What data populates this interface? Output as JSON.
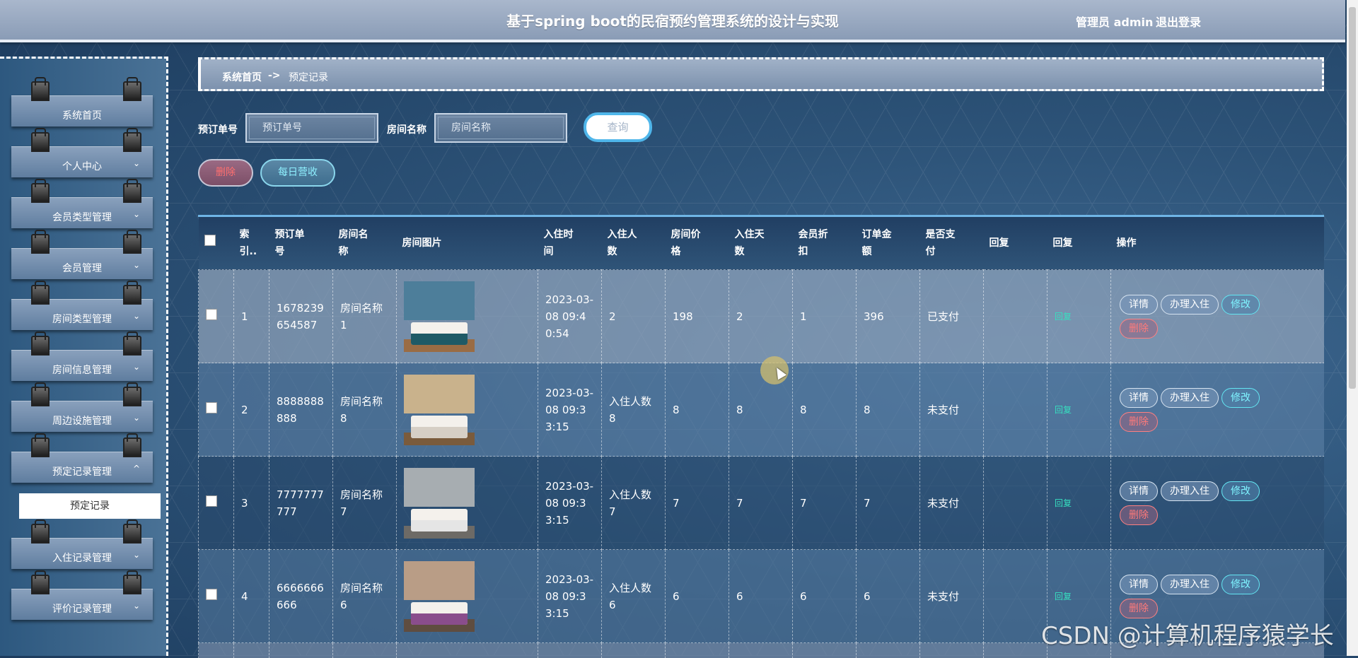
{
  "header": {
    "title": "基于spring boot的民宿预约管理系统的设计与实现",
    "user": "管理员 admin",
    "logout": "退出登录"
  },
  "sidebar": {
    "items": [
      {
        "label": "系统首页",
        "chevron": ""
      },
      {
        "label": "个人中心",
        "chevron": "⌄"
      },
      {
        "label": "会员类型管理",
        "chevron": "⌄"
      },
      {
        "label": "会员管理",
        "chevron": "⌄"
      },
      {
        "label": "房间类型管理",
        "chevron": "⌄"
      },
      {
        "label": "房间信息管理",
        "chevron": "⌄"
      },
      {
        "label": "周边设施管理",
        "chevron": "⌄"
      },
      {
        "label": "预定记录管理",
        "chevron": "^"
      },
      {
        "label": "入住记录管理",
        "chevron": "⌄"
      },
      {
        "label": "评价记录管理",
        "chevron": "⌄"
      }
    ],
    "submenu_active": "预定记录"
  },
  "breadcrumb": {
    "home": "系统首页",
    "sep": "->",
    "current": "预定记录"
  },
  "search": {
    "order_label": "预订单号",
    "order_placeholder": "预订单号",
    "room_label": "房间名称",
    "room_placeholder": "房间名称",
    "query": "查询"
  },
  "actions": {
    "delete": "删除",
    "daily_revenue": "每日营收"
  },
  "table": {
    "headers": [
      "",
      "索引",
      "预订单号",
      "房间名称",
      "房间图片",
      "入住时间",
      "入住人数",
      "房间价格",
      "入住天数",
      "会员折扣",
      "订单金额",
      "是否支付",
      "回复",
      "回复",
      "操作"
    ],
    "header_display": {
      "index": "索\n引..",
      "order_no": "预订单\n号",
      "room_name": "房间名\n称",
      "room_img": "房间图片",
      "checkin_time": "入住时\n间",
      "people": "入住人\n数",
      "price": "房间价\n格",
      "days": "入住天\n数",
      "discount": "会员折\n扣",
      "amount": "订单金\n额",
      "paid": "是否支\n付",
      "reply1": "回复",
      "reply2": "回复",
      "ops": "操作"
    },
    "rows": [
      {
        "index": "1",
        "order_no": "1678239654587",
        "room_name": "房间名称1",
        "time": "2023-03-08 09:40:54",
        "people": "2",
        "price": "198",
        "days": "2",
        "discount": "1",
        "amount": "396",
        "paid": "已支付",
        "reply": "回复",
        "img": {
          "wall": "#4d7e9a",
          "blanket": "#1f5a66",
          "floor": "#9a6c44"
        }
      },
      {
        "index": "2",
        "order_no": "8888888888",
        "room_name": "房间名称8",
        "time": "2023-03-08 09:33:15",
        "people": "入住人数8",
        "price": "8",
        "days": "8",
        "discount": "8",
        "amount": "8",
        "paid": "未支付",
        "reply": "回复",
        "img": {
          "wall": "#c9b28c",
          "blanket": "#d6cfc5",
          "floor": "#7a5b3c"
        }
      },
      {
        "index": "3",
        "order_no": "7777777777",
        "room_name": "房间名称7",
        "time": "2023-03-08 09:33:15",
        "people": "入住人数7",
        "price": "7",
        "days": "7",
        "discount": "7",
        "amount": "7",
        "paid": "未支付",
        "reply": "回复",
        "img": {
          "wall": "#a7adb1",
          "blanket": "#e5e5e5",
          "floor": "#6d6a66"
        }
      },
      {
        "index": "4",
        "order_no": "6666666666",
        "room_name": "房间名称6",
        "time": "2023-03-08 09:33:15",
        "people": "入住人数6",
        "price": "6",
        "days": "6",
        "discount": "6",
        "amount": "6",
        "paid": "未支付",
        "reply": "回复",
        "img": {
          "wall": "#b99d86",
          "blanket": "#8a4d8c",
          "floor": "#5f4d40"
        }
      }
    ],
    "row_buttons": {
      "detail": "详情",
      "checkin": "办理入住",
      "edit": "修改",
      "delete": "删除"
    }
  },
  "watermark": "CSDN @计算机程序猿学长"
}
